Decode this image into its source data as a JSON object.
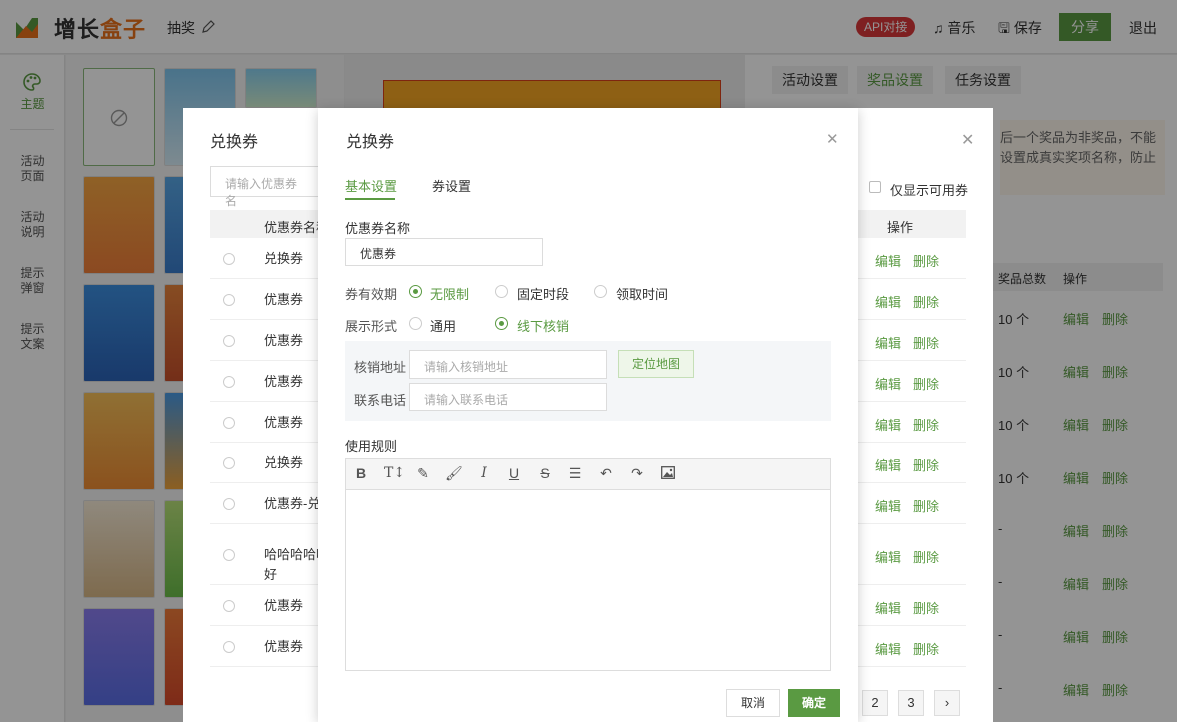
{
  "header": {
    "logo_text_a": "增长",
    "logo_text_b": "盒子",
    "title": "抽奖",
    "api_badge": "API对接",
    "music": "音乐",
    "save": "保存",
    "share": "分享",
    "logout": "退出",
    "brand_color": "#5a9a42"
  },
  "sidebar": {
    "items": [
      {
        "label": "主题",
        "icon": "palette-icon"
      },
      {
        "label": "活动\n页面"
      },
      {
        "label": "活动\n说明"
      },
      {
        "label": "提示\n弹窗"
      },
      {
        "label": "提示\n文案"
      }
    ]
  },
  "right_panel": {
    "tabs": [
      "活动设置",
      "奖品设置",
      "任务设置"
    ],
    "notice_lines": [
      "后一个奖品为非奖品，不能",
      "设置成真实奖项名称，防止"
    ],
    "col_total": "奖品总数",
    "col_op": "操作",
    "counts": [
      "10 个",
      "10 个",
      "10 个",
      "10 个",
      "-",
      "-",
      "-",
      "-"
    ],
    "edit": "编辑",
    "delete": "删除"
  },
  "bg_dialog": {
    "title": "兑换券",
    "search_placeholder": "请输入优惠券名",
    "only_available": "仅显示可用券",
    "col_name": "优惠券名称",
    "col_op": "操作",
    "rows": [
      "兑换券",
      "优惠券",
      "优惠券",
      "优惠券",
      "优惠券",
      "兑换券",
      "优惠券-兑",
      "哈哈哈哈哈好",
      "优惠券",
      "优惠券"
    ],
    "edit": "编辑",
    "delete": "删除",
    "pages": [
      "2",
      "3",
      "›"
    ]
  },
  "dialog": {
    "title": "兑换券",
    "tabs": {
      "basic": "基本设置",
      "coupon": "券设置"
    },
    "name_label": "优惠券名称",
    "name_value": "优惠券",
    "validity_label": "券有效期",
    "validity_options": [
      "无限制",
      "固定时段",
      "领取时间"
    ],
    "validity_selected": "无限制",
    "display_label": "展示形式",
    "display_options": [
      "通用",
      "线下核销"
    ],
    "display_selected": "线下核销",
    "addr_label": "核销地址",
    "addr_placeholder": "请输入核销地址",
    "locate_button": "定位地图",
    "phone_label": "联系电话",
    "phone_placeholder": "请输入联系电话",
    "rule_label": "使用规则",
    "toolbar_icons": [
      "bold-icon",
      "text-size-icon",
      "highlighter-icon",
      "brush-icon",
      "italic-icon",
      "underline-icon",
      "strikethrough-icon",
      "align-icon",
      "undo-icon",
      "redo-icon",
      "image-icon"
    ],
    "cancel": "取消",
    "ok": "确定"
  }
}
